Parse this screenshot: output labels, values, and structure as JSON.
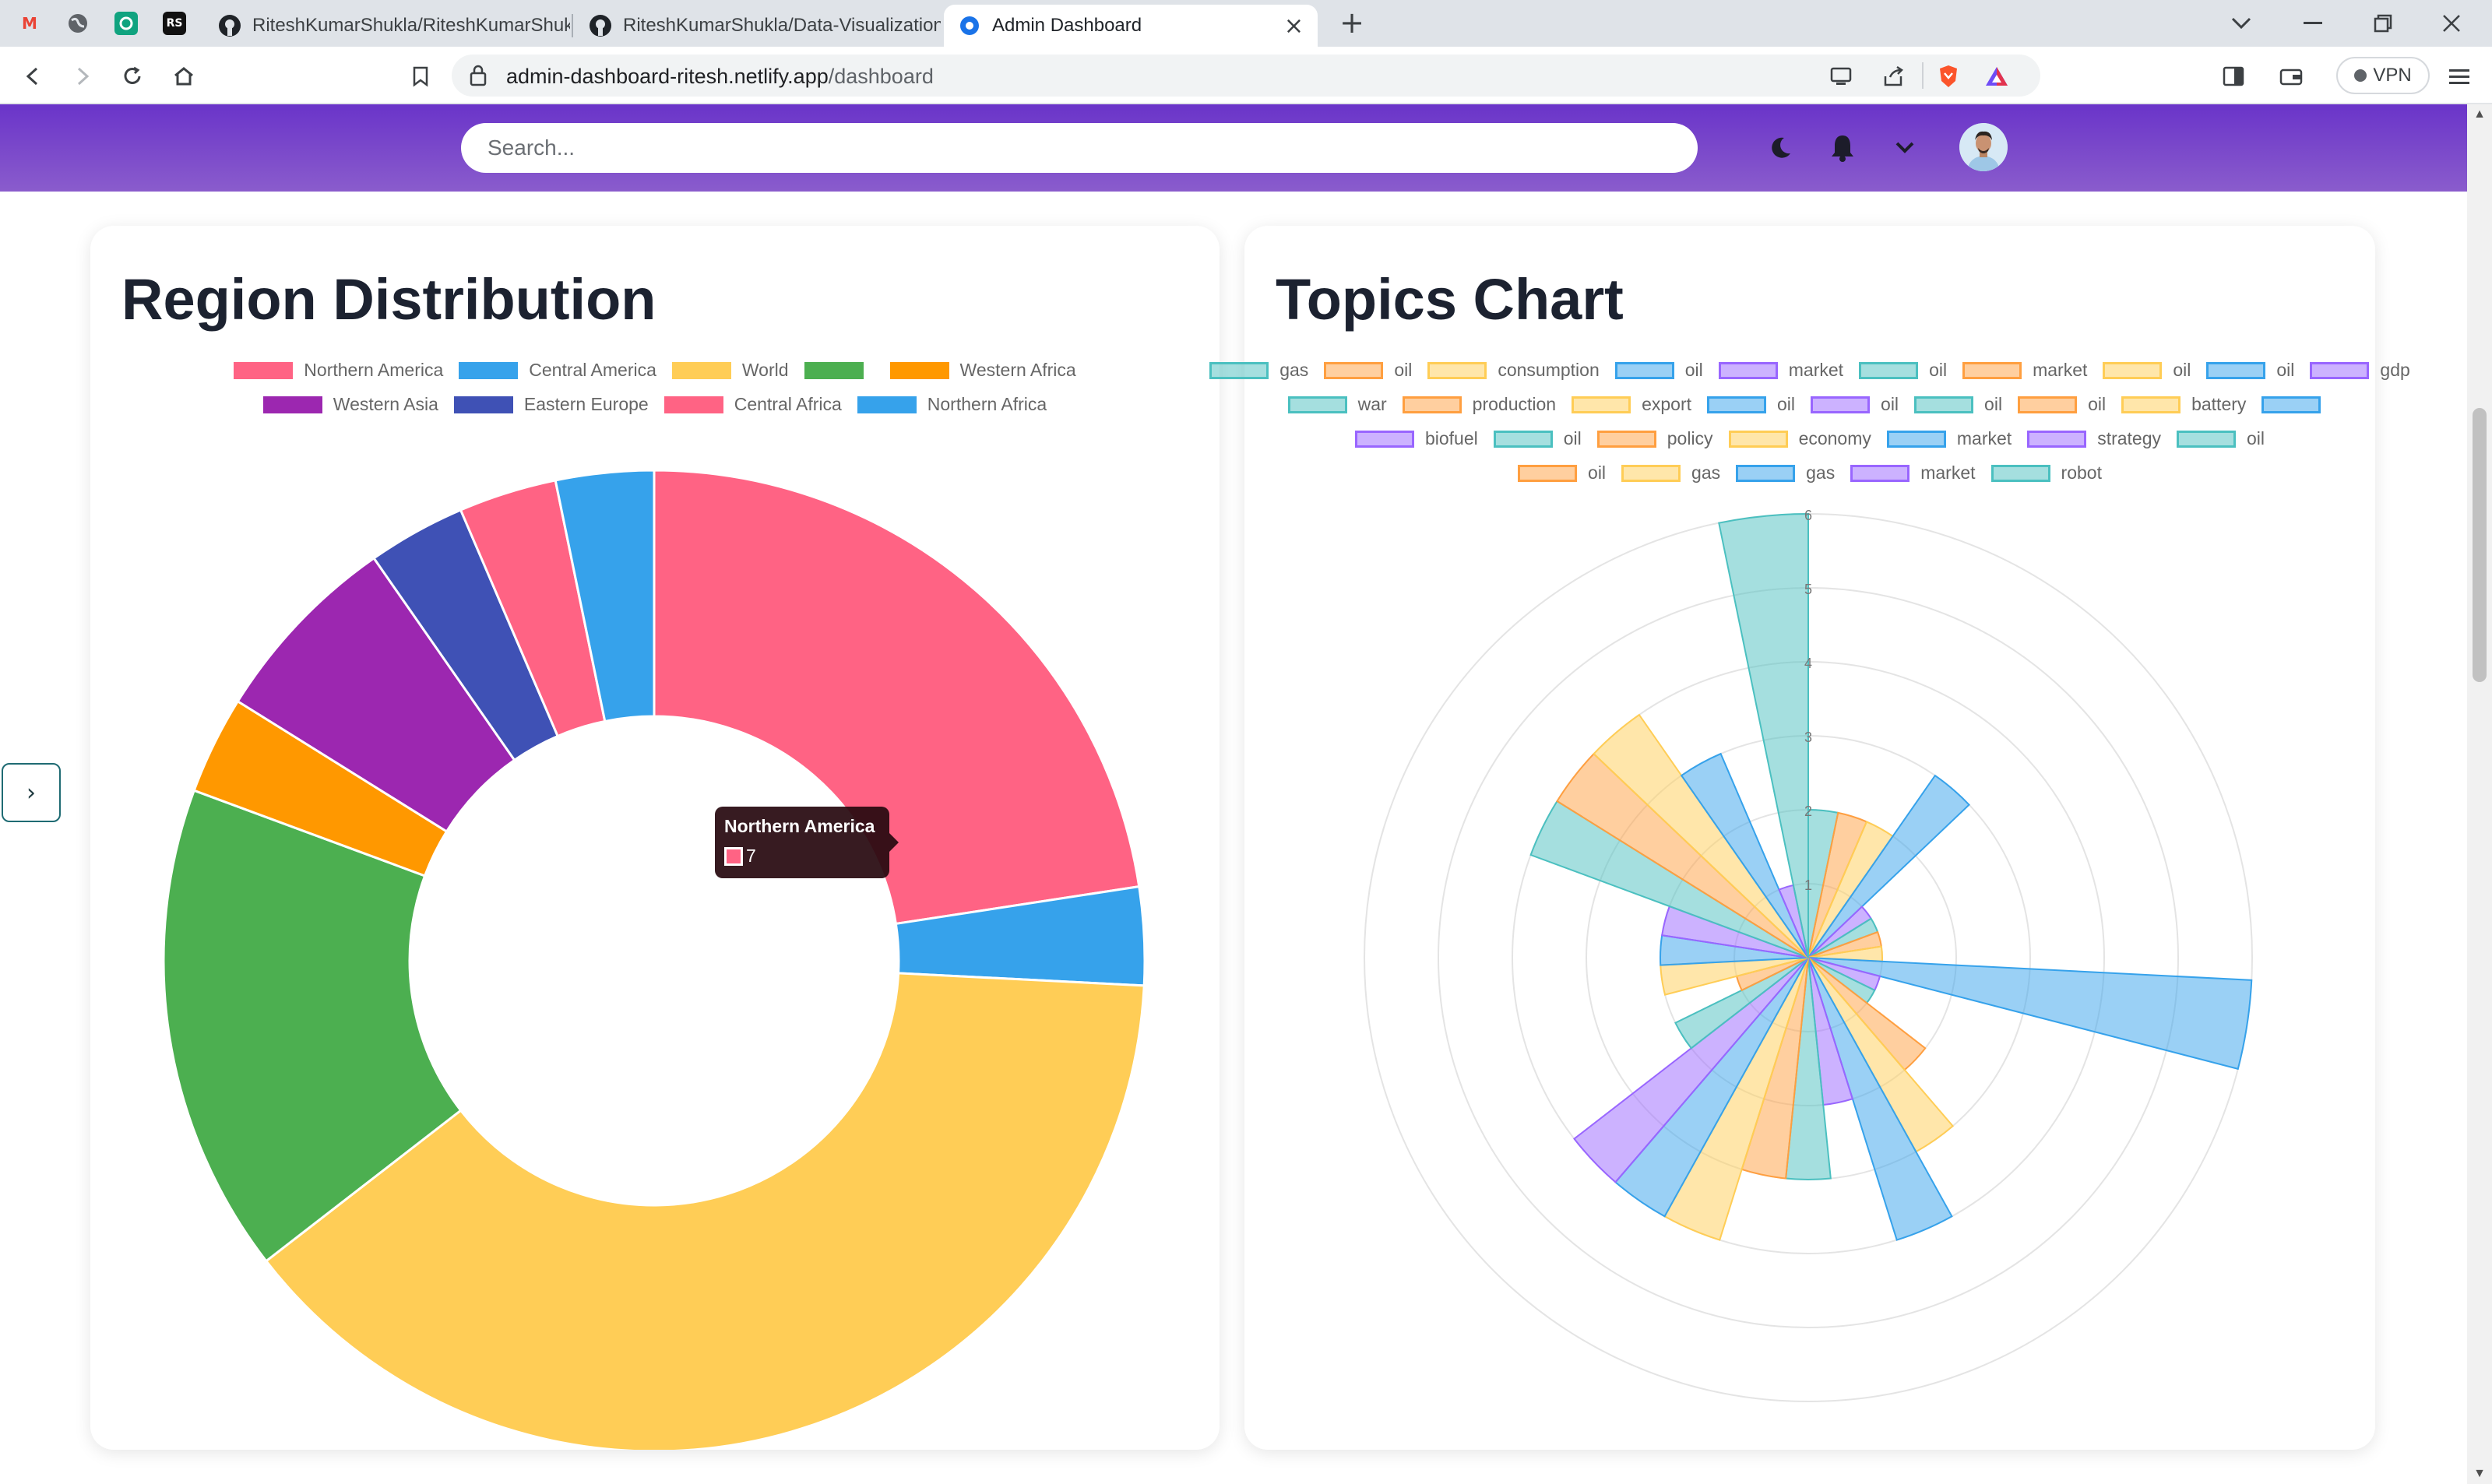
{
  "browser": {
    "tabs": [
      {
        "label": "RiteshKumarShukla/RiteshKumarShukla",
        "active": false
      },
      {
        "label": "RiteshKumarShukla/Data-Visualization",
        "active": false
      },
      {
        "label": "Admin Dashboard",
        "active": true
      }
    ],
    "url_domain": "admin-dashboard-ritesh.netlify.app",
    "url_path": "/dashboard",
    "vpn_label": "VPN"
  },
  "header": {
    "search_placeholder": "Search..."
  },
  "region_chart": {
    "title": "Region Distribution",
    "tooltip": {
      "label": "Northern America",
      "value": "7"
    }
  },
  "topics_chart": {
    "title": "Topics Chart"
  },
  "chart_data": [
    {
      "type": "doughnut",
      "title": "Region Distribution",
      "labels": [
        "Northern America",
        "Central America",
        "World",
        "",
        "Western Africa",
        "Western Asia",
        "Eastern Europe",
        "Central Africa",
        "Northern Africa"
      ],
      "values": [
        7,
        1,
        12,
        5,
        1,
        2,
        1,
        1,
        1
      ],
      "colors": [
        "#ff6384",
        "#36a2eb",
        "#ffcd56",
        "#4caf50",
        "#ff9800",
        "#9c27b0",
        "#3f51b5",
        "#ff6384",
        "#36a2eb"
      ],
      "legend": "top"
    },
    {
      "type": "polarArea",
      "title": "Topics Chart",
      "labels": [
        "gas",
        "oil",
        "consumption",
        "oil",
        "market",
        "oil",
        "market",
        "oil",
        "oil",
        "gdp",
        "war",
        "production",
        "export",
        "oil",
        "oil",
        "oil",
        "oil",
        "battery",
        "",
        "biofuel",
        "oil",
        "policy",
        "economy",
        "market",
        "strategy",
        "oil",
        "oil",
        "gas",
        "gas",
        "market",
        "robot"
      ],
      "values": [
        2,
        2,
        2,
        3,
        1,
        1,
        1,
        1,
        6,
        1,
        1,
        2,
        3,
        4,
        2,
        3,
        3,
        4,
        4,
        4,
        2,
        1,
        2,
        2,
        2,
        4,
        4,
        4,
        3,
        1,
        6
      ],
      "colors": [
        "#4bc0c0",
        "#ff9f40",
        "#ffcd56",
        "#36a2eb",
        "#9966ff"
      ],
      "r_ticks": [
        "1",
        "2",
        "3",
        "4",
        "5",
        "6"
      ],
      "r_max": 6,
      "legend": "top"
    }
  ]
}
